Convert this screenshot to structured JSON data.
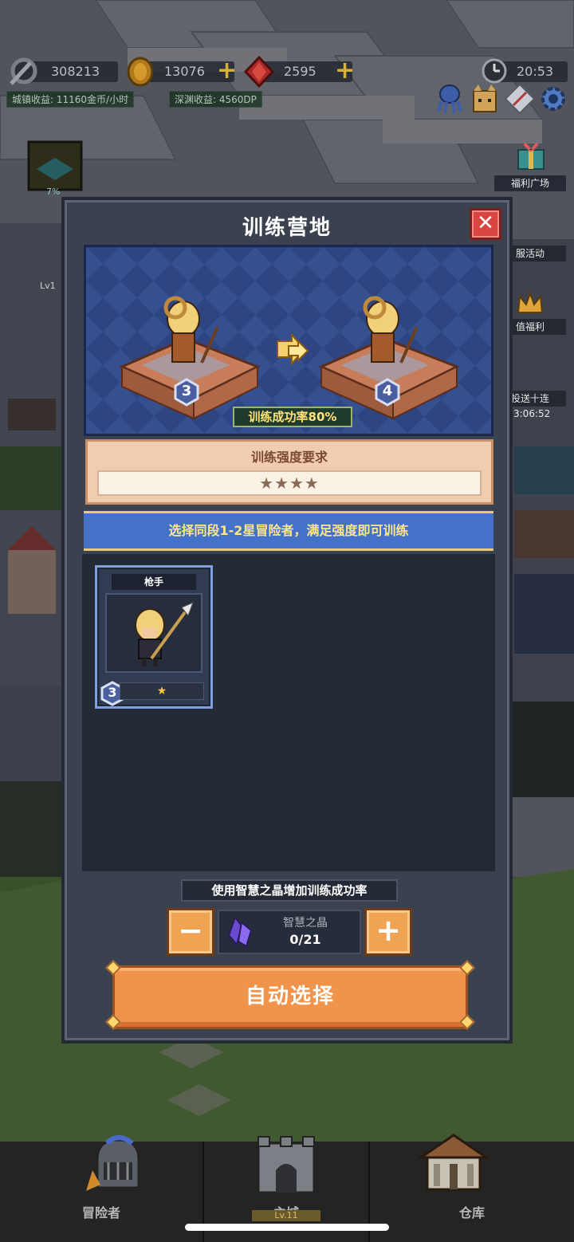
{
  "hud": {
    "power": "308213",
    "gold": "13076",
    "gems": "2595",
    "time": "20:53",
    "town_income": "城镇收益: 11160金币/小时",
    "abyss_income": "深渊收益: 4560DP",
    "build_progress": "7%",
    "building_level": "Lv1"
  },
  "side_buttons": {
    "welfare_plaza": "福利广场",
    "server_event": "服活动",
    "value_welfare": "值福利",
    "free_ten_draw": "投送十连",
    "free_ten_timer": "3:06:52"
  },
  "modal": {
    "title": "训练营地",
    "close_icon": "close-icon",
    "stage": {
      "from_tier": "3",
      "to_tier": "4",
      "success_rate": "训练成功率80%"
    },
    "requirement": {
      "title": "训练强度要求",
      "stars": "★★★★",
      "stars_count": 4
    },
    "hint": "选择同段1-2星冒险者，满足强度即可训练",
    "candidates": [
      {
        "name": "枪手",
        "tier": "3",
        "stars": "★"
      }
    ],
    "crystal": {
      "label": "使用智慧之晶增加训练成功率",
      "name": "智慧之晶",
      "count": "0/21",
      "minus": "−",
      "plus": "+"
    },
    "auto_select": "自动选择"
  },
  "nav": {
    "adventurers": "冒险者",
    "main_city": "主城",
    "main_city_level": "Lv.11",
    "warehouse": "仓库"
  },
  "colors": {
    "accent_orange": "#f0934b",
    "hint_blue": "#4472c9",
    "success_text": "#ffe27a",
    "star_gold": "#f5c842"
  }
}
